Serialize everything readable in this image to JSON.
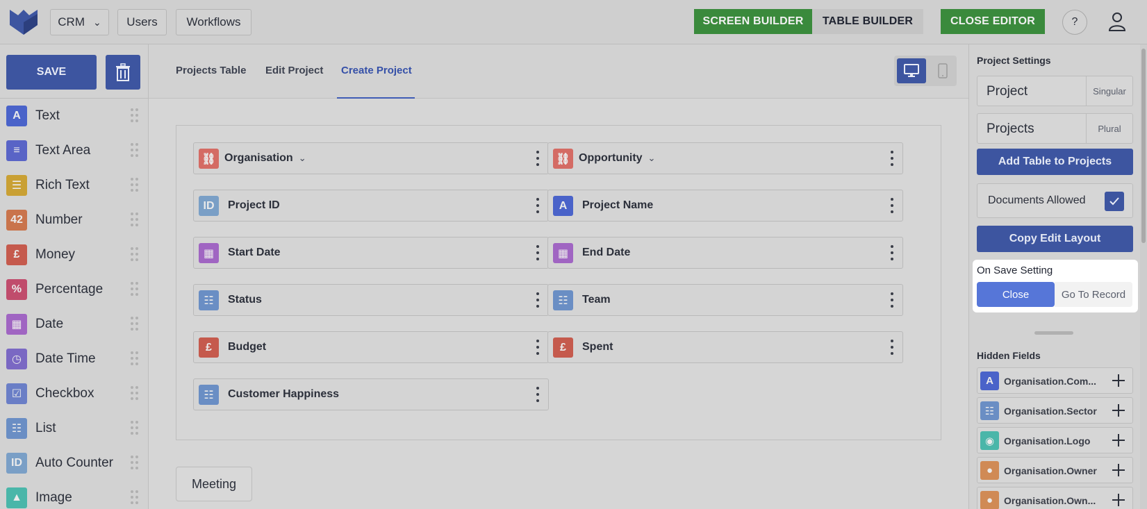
{
  "colors": {
    "brand_blue": "#3d55a0",
    "green": "#3a8a3c",
    "active_tab": "#3550a8",
    "highlight_option": "#5676d8"
  },
  "topbar": {
    "app_select": "CRM",
    "users": "Users",
    "workflows": "Workflows",
    "screen_builder": "SCREEN BUILDER",
    "table_builder": "TABLE BUILDER",
    "close_editor": "CLOSE EDITOR",
    "help": "?"
  },
  "sidebar": {
    "save": "SAVE",
    "items": [
      {
        "label": "Text",
        "icon": "text-icon",
        "glyph": "A",
        "color": "#4a63c9"
      },
      {
        "label": "Text Area",
        "icon": "text-area-icon",
        "glyph": "≡",
        "color": "#5964c6"
      },
      {
        "label": "Rich Text",
        "icon": "rich-text-icon",
        "glyph": "☰",
        "color": "#c9a034"
      },
      {
        "label": "Number",
        "icon": "number-icon",
        "glyph": "42",
        "color": "#c9744c"
      },
      {
        "label": "Money",
        "icon": "money-icon",
        "glyph": "£",
        "color": "#c55a4d"
      },
      {
        "label": "Percentage",
        "icon": "percentage-icon",
        "glyph": "%",
        "color": "#c04c6c"
      },
      {
        "label": "Date",
        "icon": "date-icon",
        "glyph": "▦",
        "color": "#a065c2"
      },
      {
        "label": "Date Time",
        "icon": "date-time-icon",
        "glyph": "◷",
        "color": "#7a68c3"
      },
      {
        "label": "Checkbox",
        "icon": "checkbox-icon",
        "glyph": "☑",
        "color": "#6a7ec6"
      },
      {
        "label": "List",
        "icon": "list-icon",
        "glyph": "☷",
        "color": "#6a8ec4"
      },
      {
        "label": "Auto Counter",
        "icon": "auto-counter-icon",
        "glyph": "ID",
        "color": "#7a9fc6"
      },
      {
        "label": "Image",
        "icon": "image-icon",
        "glyph": "▲",
        "color": "#4ab6a9"
      }
    ]
  },
  "main": {
    "tabs": [
      "Projects Table",
      "Edit Project",
      "Create Project"
    ],
    "active_tab": "Create Project",
    "fields": [
      {
        "label": "Organisation",
        "icon": "link-icon",
        "glyph": "⛓",
        "color": "#d46b64",
        "dropdown": true
      },
      {
        "label": "Opportunity",
        "icon": "link-icon",
        "glyph": "⛓",
        "color": "#d46b64",
        "dropdown": true
      },
      {
        "label": "Project ID",
        "icon": "auto-counter-icon",
        "glyph": "ID",
        "color": "#7a9fc6"
      },
      {
        "label": "Project Name",
        "icon": "text-icon",
        "glyph": "A",
        "color": "#4a63c9"
      },
      {
        "label": "Start Date",
        "icon": "date-icon",
        "glyph": "▦",
        "color": "#a065c2"
      },
      {
        "label": "End Date",
        "icon": "date-icon",
        "glyph": "▦",
        "color": "#a065c2"
      },
      {
        "label": "Status",
        "icon": "list-icon",
        "glyph": "☷",
        "color": "#6a8ec4"
      },
      {
        "label": "Team",
        "icon": "list-icon",
        "glyph": "☷",
        "color": "#6a8ec4"
      },
      {
        "label": "Budget",
        "icon": "money-icon",
        "glyph": "£",
        "color": "#c55a4d"
      },
      {
        "label": "Spent",
        "icon": "money-icon",
        "glyph": "£",
        "color": "#c55a4d"
      },
      {
        "label": "Customer Happiness",
        "icon": "list-icon",
        "glyph": "☷",
        "color": "#6a8ec4"
      }
    ],
    "meeting": "Meeting"
  },
  "settings": {
    "title": "Project  Settings",
    "singular_value": "Project",
    "singular_label": "Singular",
    "plural_value": "Projects",
    "plural_label": "Plural",
    "add_table": "Add Table to Projects",
    "documents_allowed": "Documents Allowed",
    "copy_edit_layout": "Copy Edit Layout",
    "on_save_label": "On Save Setting",
    "on_save_close": "Close",
    "on_save_goto": "Go To Record",
    "hidden_fields_title": "Hidden Fields",
    "hidden_fields": [
      {
        "label": "Organisation.Com...",
        "icon": "text-icon",
        "glyph": "A",
        "color": "#4a63c9"
      },
      {
        "label": "Organisation.Sector",
        "icon": "list-icon",
        "glyph": "☷",
        "color": "#6a8ec4"
      },
      {
        "label": "Organisation.Logo",
        "icon": "image-icon",
        "glyph": "◉",
        "color": "#4ab6a9"
      },
      {
        "label": "Organisation.Owner",
        "icon": "user-icon",
        "glyph": "●",
        "color": "#d08a55"
      },
      {
        "label": "Organisation.Own...",
        "icon": "user-icon",
        "glyph": "●",
        "color": "#d08a55"
      }
    ]
  }
}
